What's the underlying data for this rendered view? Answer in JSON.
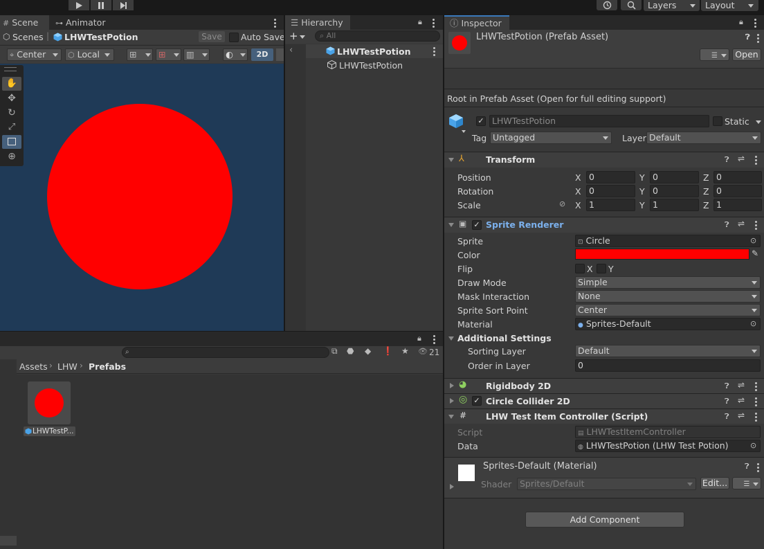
{
  "toolbar": {
    "layers_label": "Layers",
    "layout_label": "Layout"
  },
  "scene": {
    "tab_scene": "Scene",
    "tab_animator": "Animator",
    "breadcrumb_scenes": "Scenes",
    "breadcrumb_prefab": "LHWTestPotion",
    "save_label": "Save",
    "autosave_label": "Auto Save",
    "pivot_label": "Center",
    "space_label": "Local",
    "mode_2d": "2D",
    "background_color": "#1f3a57",
    "circle_color": "#ff0000"
  },
  "hierarchy": {
    "tab_label": "Hierarchy",
    "search_placeholder": "All",
    "root_item": "LHWTestPotion",
    "child_item": "LHWTestPotion"
  },
  "project": {
    "breadcrumb": [
      "Assets",
      "LHW",
      "Prefabs"
    ],
    "count": "21",
    "asset_name": "LHWTestP..."
  },
  "inspector": {
    "tab_label": "Inspector",
    "title": "LHWTestPotion (Prefab Asset)",
    "open_label": "Open",
    "root_note": "Root in Prefab Asset (Open for full editing support)",
    "object_name": "LHWTestPotion",
    "static_label": "Static",
    "tag_label": "Tag",
    "tag_value": "Untagged",
    "layer_label": "Layer",
    "layer_value": "Default",
    "transform": {
      "title": "Transform",
      "rows": [
        {
          "label": "Position",
          "x": "0",
          "y": "0",
          "z": "0"
        },
        {
          "label": "Rotation",
          "x": "0",
          "y": "0",
          "z": "0"
        },
        {
          "label": "Scale",
          "x": "1",
          "y": "1",
          "z": "1"
        }
      ],
      "axis_x": "X",
      "axis_y": "Y",
      "axis_z": "Z"
    },
    "sprite_renderer": {
      "title": "Sprite Renderer",
      "sprite_label": "Sprite",
      "sprite_value": "Circle",
      "color_label": "Color",
      "color_value": "#ff0000",
      "flip_label": "Flip",
      "flip_x": "X",
      "flip_y": "Y",
      "draw_mode_label": "Draw Mode",
      "draw_mode_value": "Simple",
      "mask_label": "Mask Interaction",
      "mask_value": "None",
      "sort_point_label": "Sprite Sort Point",
      "sort_point_value": "Center",
      "material_label": "Material",
      "material_value": "Sprites-Default",
      "additional_label": "Additional Settings",
      "sorting_layer_label": "Sorting Layer",
      "sorting_layer_value": "Default",
      "order_label": "Order in Layer",
      "order_value": "0"
    },
    "rigidbody_title": "Rigidbody 2D",
    "collider_title": "Circle Collider 2D",
    "script_component": {
      "title": "LHW Test Item Controller (Script)",
      "script_label": "Script",
      "script_value": "LHWTestItemController",
      "data_label": "Data",
      "data_value": "LHWTestPotion (LHW Test Potion)"
    },
    "material": {
      "title": "Sprites-Default (Material)",
      "shader_label": "Shader",
      "shader_value": "Sprites/Default",
      "edit_label": "Edit..."
    },
    "add_component_label": "Add Component"
  }
}
